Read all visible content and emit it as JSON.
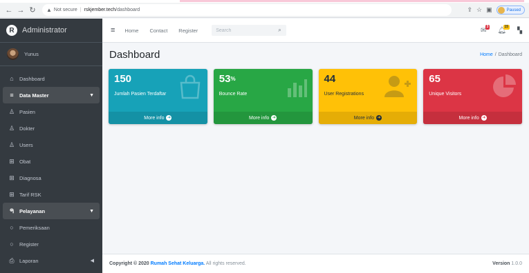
{
  "browser": {
    "insecure_label": "Not secure",
    "url_host": "rskjember.tech",
    "url_path": "/dashboard",
    "profile_status": "Paused"
  },
  "sidebar": {
    "brand": "Administrator",
    "user_name": "Yunus",
    "items": [
      {
        "label": "Dashboard",
        "icon": "home-icon"
      },
      {
        "label": "Data Master",
        "icon": "database-icon"
      },
      {
        "label": "Pasien",
        "icon": "user-icon"
      },
      {
        "label": "Dokter",
        "icon": "user-icon"
      },
      {
        "label": "Users",
        "icon": "user-icon"
      },
      {
        "label": "Obat",
        "icon": "table-icon"
      },
      {
        "label": "Diagnosa",
        "icon": "table-icon"
      },
      {
        "label": "Tarif RSK",
        "icon": "table-icon"
      },
      {
        "label": "Pelayanan",
        "icon": "hands-icon"
      },
      {
        "label": "Pemeriksaan",
        "icon": "circle-icon"
      },
      {
        "label": "Register",
        "icon": "circle-icon"
      },
      {
        "label": "Laporan",
        "icon": "print-icon"
      }
    ]
  },
  "topnav": {
    "links": [
      "Home",
      "Contact",
      "Register"
    ],
    "search_placeholder": "Search",
    "messages_badge": "3",
    "notifications_badge": "15"
  },
  "content": {
    "title": "Dashboard",
    "breadcrumb": {
      "home": "Home",
      "sep": "/",
      "current": "Dashboard"
    }
  },
  "boxes": [
    {
      "value": "150",
      "sup": "",
      "label": "Jumlah Pasien Terdaftar",
      "footer": "More info",
      "color": "#17a2b8",
      "icon": "shopping-bag-icon"
    },
    {
      "value": "53",
      "sup": "%",
      "label": "Bounce Rate",
      "footer": "More info",
      "color": "#28a745",
      "icon": "bar-chart-icon"
    },
    {
      "value": "44",
      "sup": "",
      "label": "User Registrations",
      "footer": "More info",
      "color": "#ffc107",
      "icon": "user-plus-icon"
    },
    {
      "value": "65",
      "sup": "",
      "label": "Unique Visitors",
      "footer": "More info",
      "color": "#dc3545",
      "icon": "pie-chart-icon"
    }
  ],
  "footer": {
    "copyright_prefix": "Copyright © 2020",
    "brand_link": "Rumah Sehat Keluarga.",
    "rights": "All rights reserved.",
    "version_label": "Version",
    "version_value": "1.0.0"
  }
}
